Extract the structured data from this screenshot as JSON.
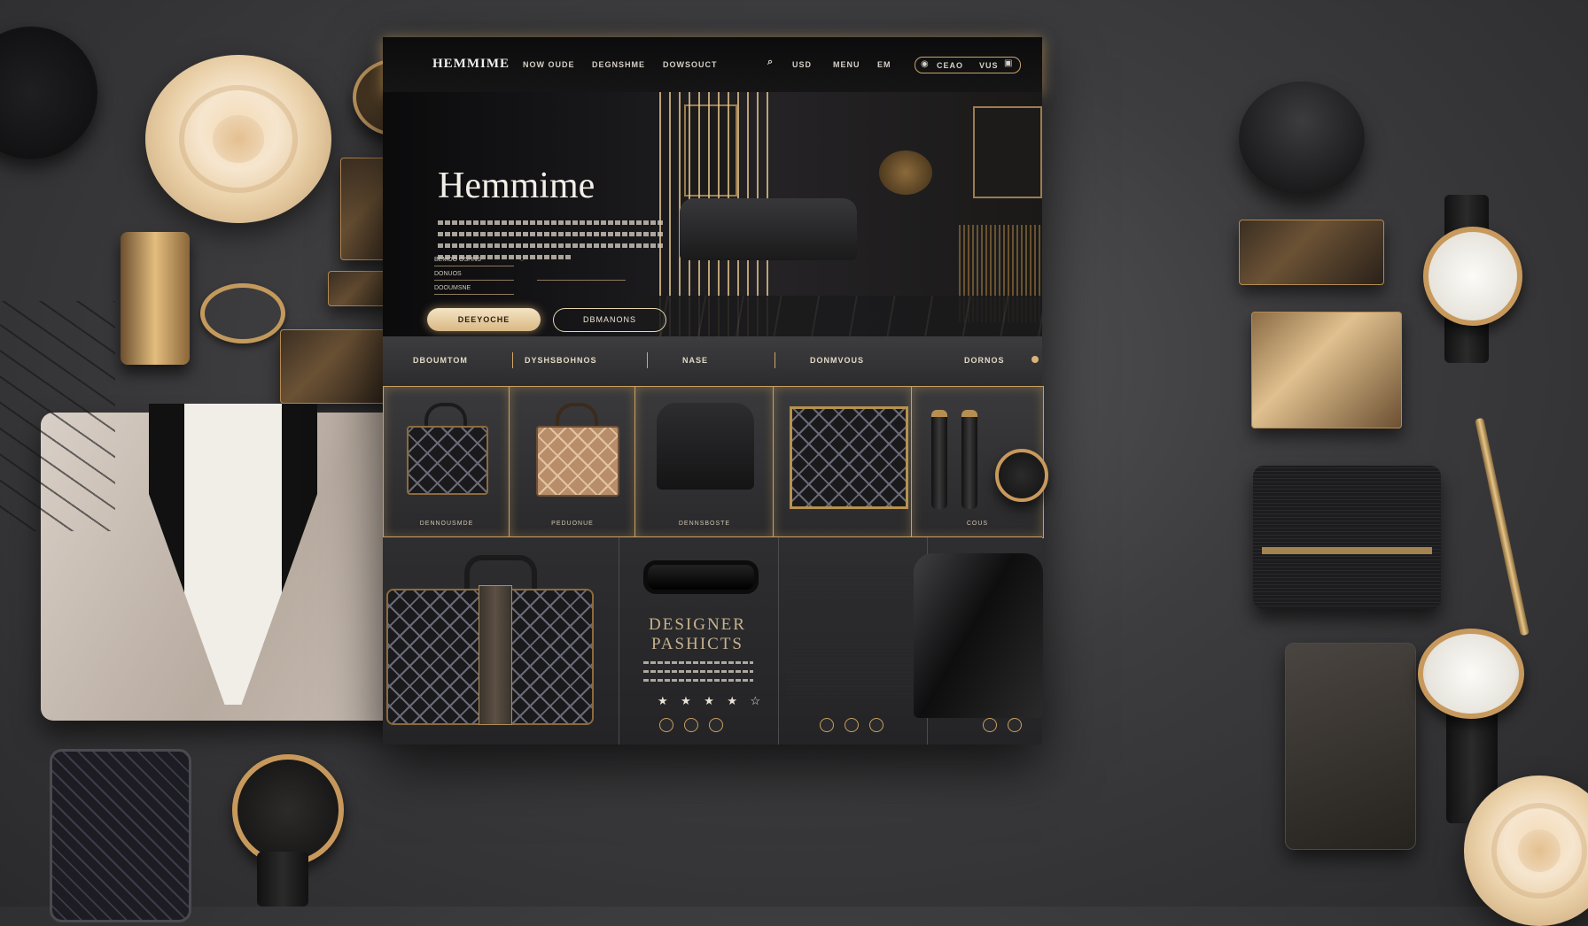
{
  "site": {
    "logo": "HEMMIME",
    "nav_links": [
      "NOW OUDE",
      "DEGNSHME",
      "DOWSOUCT"
    ],
    "nav_utils": [
      "USD",
      "MENU",
      "EM"
    ],
    "nav_actions": [
      "CEAO",
      "VUS"
    ],
    "hero": {
      "title": "Hemmime",
      "form_fields": [
        "BEMOO OSHNS",
        "DONUOS",
        "DOOUMSNE"
      ],
      "primary_button": "DEEYOCHE",
      "secondary_button": "DBMANONS"
    },
    "categories": [
      "DBOUMTOM",
      "DYSHSBOHNOS",
      "NASE",
      "DONMVOUS",
      "DORNOS"
    ],
    "product_labels": [
      "DENNOUSMDE",
      "PEDUONUE",
      "DENNSBOSTE",
      "",
      "COUS"
    ],
    "promo": {
      "title_line1": "DESIGNER",
      "title_line2": "PASHICTS",
      "stars": [
        "★",
        "★",
        "★",
        "★",
        "☆"
      ]
    }
  },
  "colors": {
    "accent_gold": "#c99f61",
    "background": "#3d3d3f",
    "site_bg": "#121213"
  },
  "icons": [
    "search-icon",
    "cart-icon",
    "user-icon",
    "chevron-icon",
    "star-icon"
  ]
}
